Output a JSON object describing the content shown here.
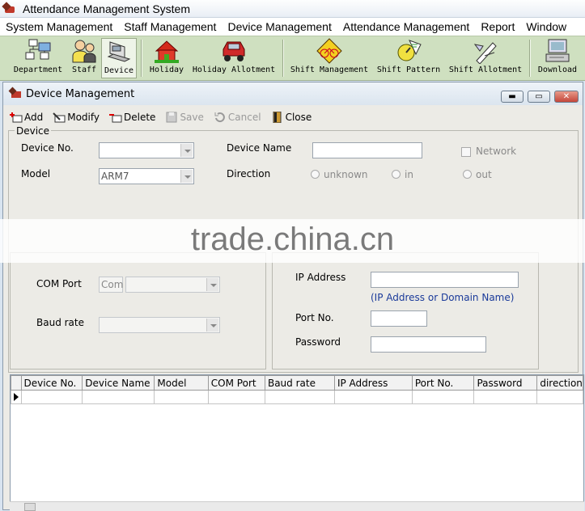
{
  "app": {
    "title": "Attendance Management System"
  },
  "menu": [
    "System Management",
    "Staff Management",
    "Device Management",
    "Attendance Management",
    "Report",
    "Window"
  ],
  "toolbar": {
    "department": "Department",
    "staff": "Staff",
    "device": "Device",
    "holiday": "Holiday",
    "holiday_allotment": "Holiday Allotment",
    "shift_management": "Shift Management",
    "shift_pattern": "Shift Pattern",
    "shift_allotment": "Shift Allotment",
    "download": "Download"
  },
  "window": {
    "title": "Device Management"
  },
  "actions": {
    "add": "Add",
    "modify": "Modify",
    "delete": "Delete",
    "save": "Save",
    "cancel": "Cancel",
    "close": "Close"
  },
  "device_group": {
    "label": "Device"
  },
  "form": {
    "device_no_label": "Device No.",
    "device_name_label": "Device Name",
    "model_label": "Model",
    "model_value": "ARM7",
    "direction_label": "Direction",
    "direction_options": [
      "unknown",
      "in",
      "out"
    ],
    "network_label": "Network",
    "com_port_label": "COM Port",
    "com_prefix": "Com",
    "baud_rate_label": "Baud rate",
    "ip_label": "IP Address",
    "ip_hint": "(IP Address or Domain Name)",
    "port_label": "Port No.",
    "password_label": "Password"
  },
  "watermark": "trade.china.cn",
  "grid": {
    "columns": [
      "Device No.",
      "Device Name",
      "Model",
      "COM Port",
      "Baud rate",
      "IP Address",
      "Port No.",
      "Password",
      "direction"
    ]
  },
  "colors": {
    "toolbar_bg": "#cfe0c0",
    "hint_blue": "#1a3a9a",
    "close_red": "#c4463a"
  }
}
